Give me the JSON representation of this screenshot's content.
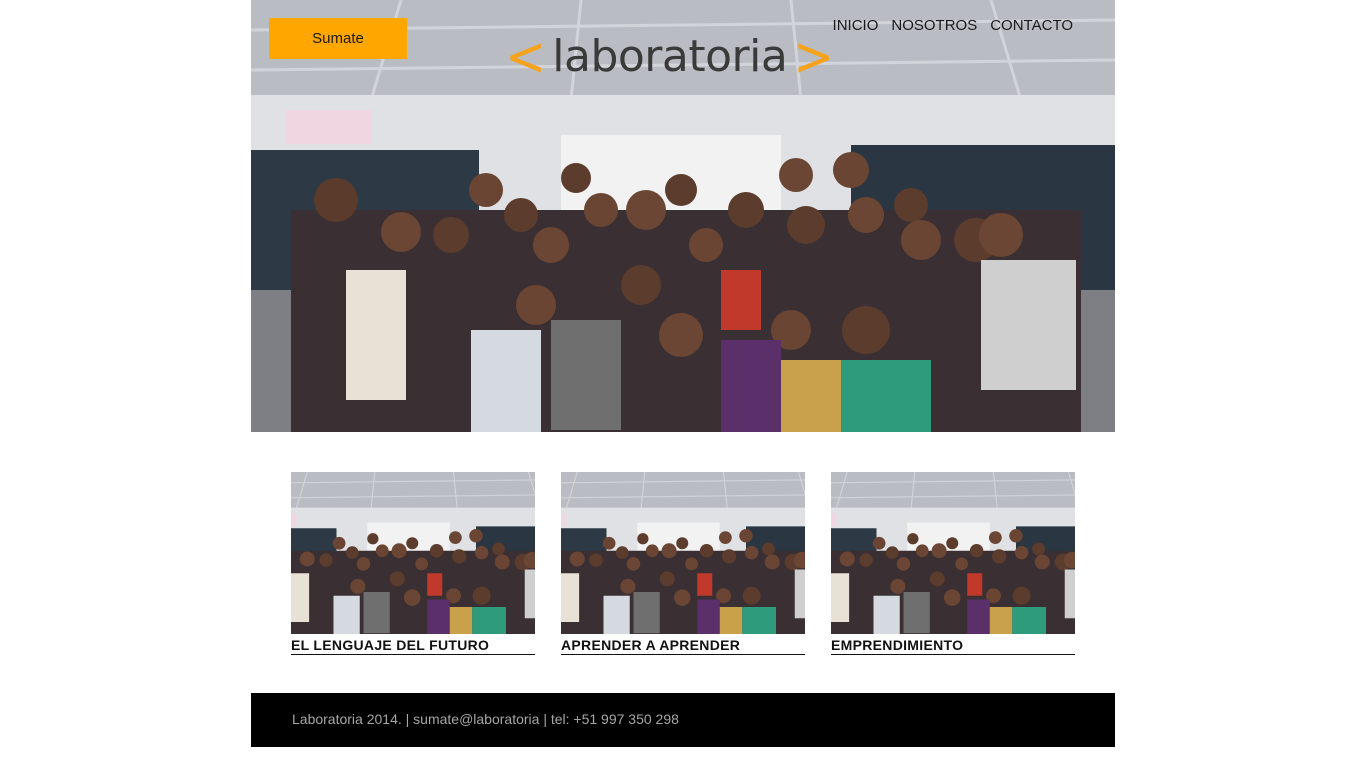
{
  "header": {
    "cta_label": "Sumate",
    "logo_text": "laboratoria",
    "logo_left_bracket": "<",
    "logo_right_bracket": ">",
    "nav": [
      {
        "label": "INICIO"
      },
      {
        "label": "NOSOTROS"
      },
      {
        "label": "CONTACTO"
      }
    ]
  },
  "hero": {
    "image": "group-photo-classroom"
  },
  "cards": [
    {
      "title": "EL LENGUAJE DEL FUTURO",
      "image": "group-photo-classroom"
    },
    {
      "title": "APRENDER A APRENDER",
      "image": "group-photo-classroom"
    },
    {
      "title": "EMPRENDIMIENTO",
      "image": "group-photo-classroom"
    }
  ],
  "footer": {
    "text": "Laboratoria 2014. | sumate@laboratoria | tel: +51 997 350 298"
  },
  "colors": {
    "accent": "#ffa600",
    "footer_bg": "#000000",
    "footer_text": "#a6a6a6"
  }
}
